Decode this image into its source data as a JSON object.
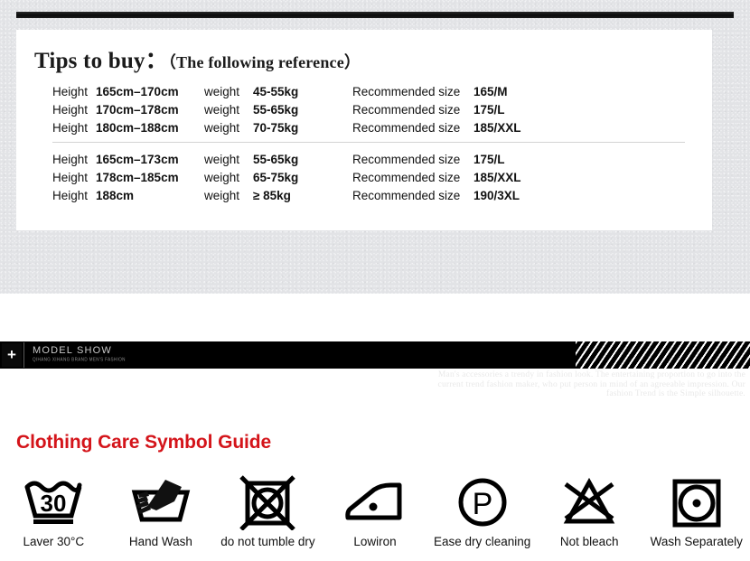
{
  "size_guide": {
    "heading_main": "Tips to buy：",
    "heading_sub": "（The following reference）",
    "labels": {
      "height": "Height",
      "weight": "weight",
      "recommended": "Recommended size"
    },
    "groups": [
      {
        "rows": [
          {
            "height": "165cm–170cm",
            "weight": "45-55kg",
            "size": "165/M"
          },
          {
            "height": "170cm–178cm",
            "weight": "55-65kg",
            "size": "175/L"
          },
          {
            "height": "180cm–188cm",
            "weight": "70-75kg",
            "size": "185/XXL"
          }
        ]
      },
      {
        "rows": [
          {
            "height": "165cm–173cm",
            "weight": "55-65kg",
            "size": "175/L"
          },
          {
            "height": "178cm–185cm",
            "weight": "65-75kg",
            "size": "185/XXL"
          },
          {
            "height": "188cm",
            "weight": "≥ 85kg",
            "size": "190/3XL"
          }
        ]
      }
    ]
  },
  "banner": {
    "plus_label": "+",
    "title": "MODEL SHOW",
    "subtitle": "QIHANG XIHANG BRAND MEN'S FASHION"
  },
  "ghost_copy": "Man's accessories a trendy in fashion look. The entertaining proportion to go into the current trend fashion maker, who put person in mind of an agreeable impression. Our fashion Trend is the Simple silhouette.",
  "care": {
    "heading": "Clothing Care Symbol Guide",
    "items": [
      {
        "icon": "wash-tub-30-icon",
        "label": "Laver 30°C",
        "value": "30"
      },
      {
        "icon": "hand-wash-icon",
        "label": "Hand Wash"
      },
      {
        "icon": "do-not-tumble-dry-icon",
        "label": "do not tumble dry"
      },
      {
        "icon": "low-iron-icon",
        "label": "Lowiron"
      },
      {
        "icon": "dry-clean-p-icon",
        "label": "Ease dry cleaning"
      },
      {
        "icon": "do-not-bleach-icon",
        "label": "Not bleach"
      },
      {
        "icon": "wash-separately-icon",
        "label": "Wash Separately"
      }
    ]
  },
  "colors": {
    "accent_red": "#d4141a",
    "banner_black": "#000000",
    "panel_white": "#ffffff",
    "page_gray": "#e2e3e6"
  }
}
